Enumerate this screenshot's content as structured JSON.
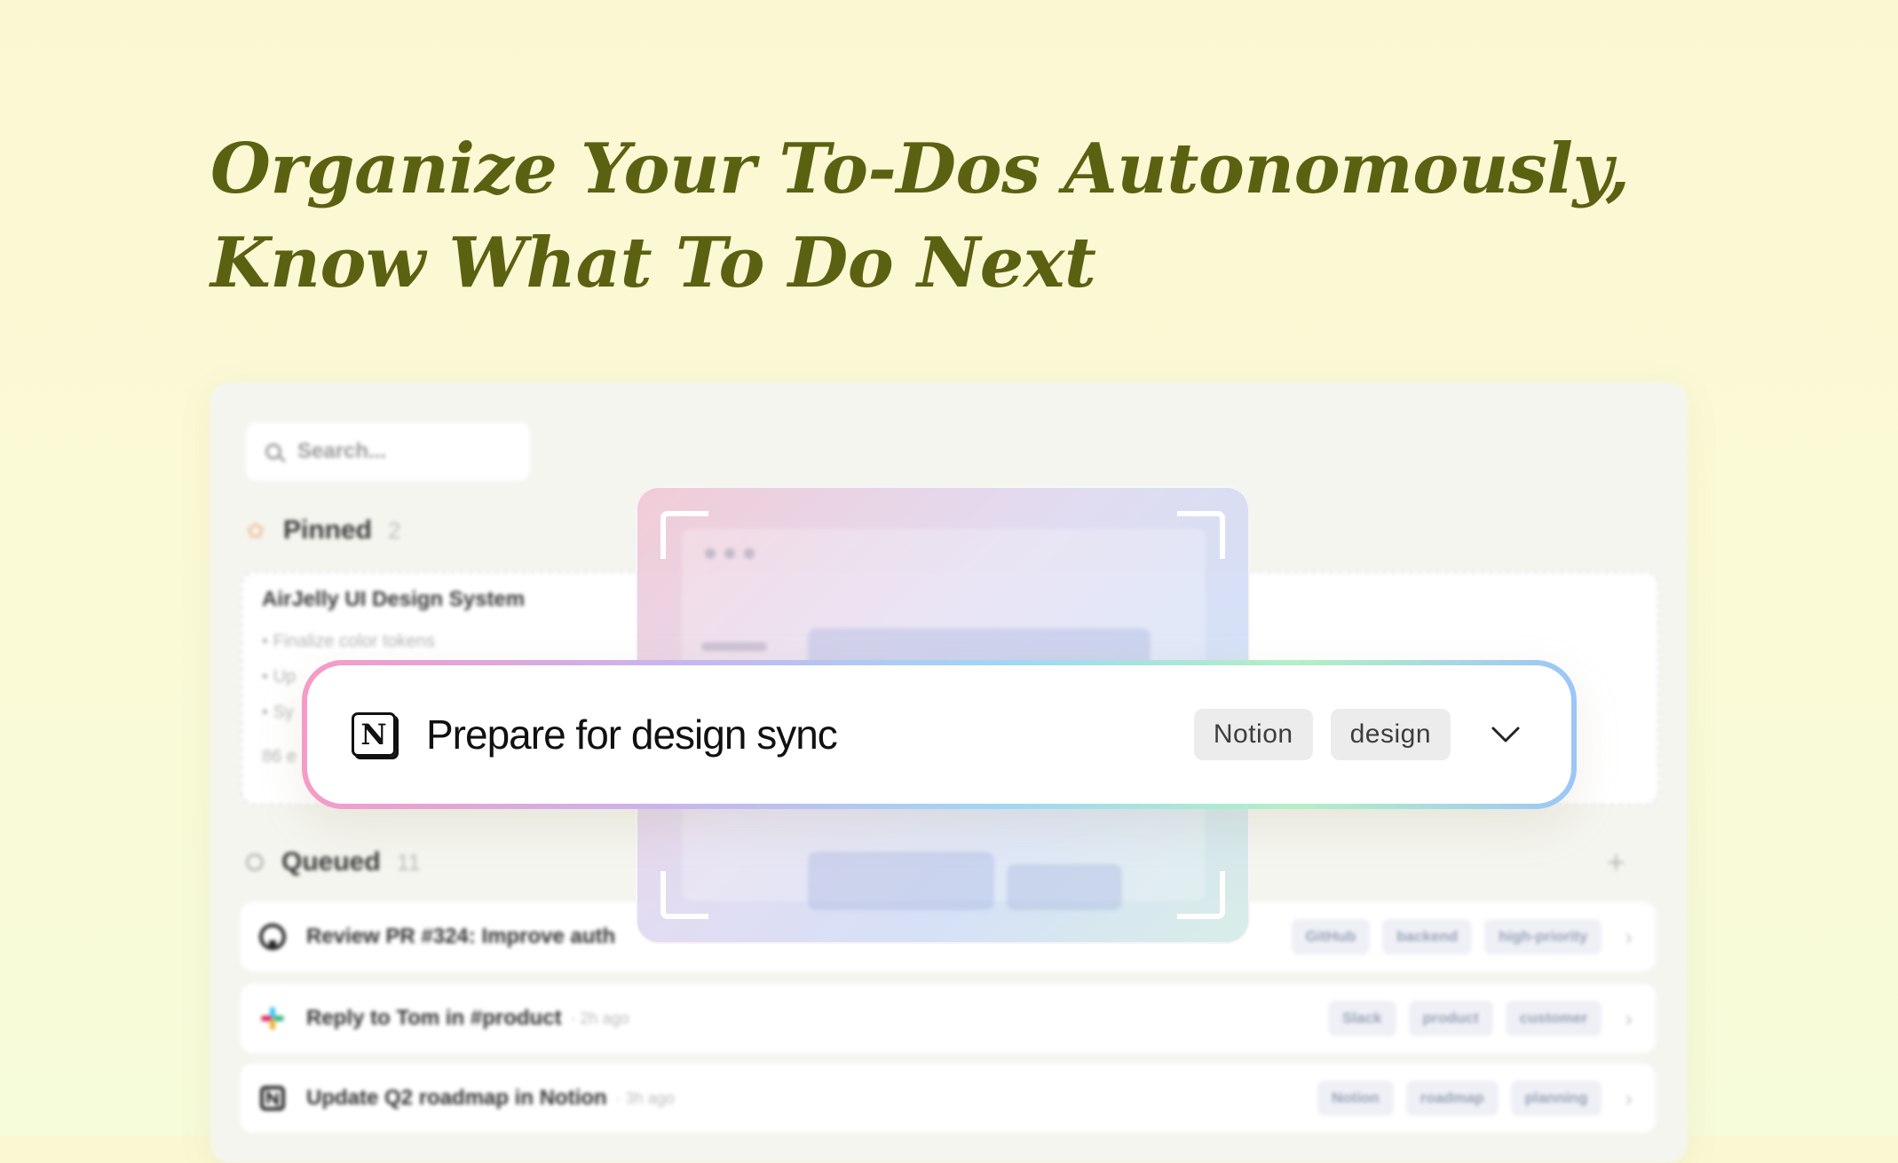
{
  "headline": {
    "line1": "Organize Your To-Dos Autonomously,",
    "line2": "Know What To Do Next"
  },
  "app": {
    "search": {
      "placeholder": "Search..."
    },
    "pinned": {
      "label": "Pinned",
      "count": "2",
      "card": {
        "title": "AirJelly UI Design System",
        "items": [
          "Finalize color tokens",
          "Up",
          "Sy"
        ],
        "meta": "86 e"
      }
    },
    "queued": {
      "label": "Queued",
      "count": "11",
      "tasks": [
        {
          "title": "Review PR #324: Improve auth",
          "time": "",
          "icon": "github-icon",
          "tags": [
            "GitHub",
            "backend",
            "high-priority"
          ]
        },
        {
          "title": "Reply to Tom in #product",
          "time": "· 2h ago",
          "icon": "slack-icon",
          "tags": [
            "Slack",
            "product",
            "customer"
          ]
        },
        {
          "title": "Update Q2 roadmap in Notion",
          "time": "· 3h ago",
          "icon": "notion-icon",
          "tags": [
            "Notion",
            "roadmap",
            "planning"
          ]
        }
      ]
    }
  },
  "feature_task": {
    "icon": "notion-icon",
    "icon_glyph": "N",
    "title": "Prepare for design sync",
    "tags": [
      "Notion",
      "design"
    ]
  },
  "colors": {
    "headline": "#5a6212",
    "background": "#fbf7d2",
    "border_gradient": [
      "#f59bc6",
      "#c7b6ef",
      "#9fd7f5",
      "#b3f0c5",
      "#9cc5f8"
    ]
  }
}
